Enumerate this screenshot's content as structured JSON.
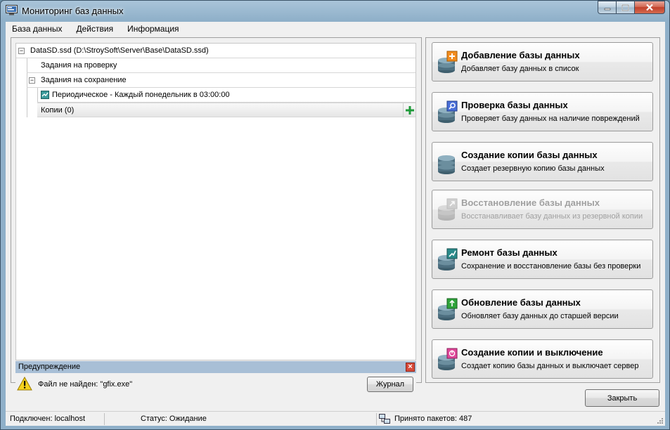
{
  "window": {
    "title": "Мониторинг баз данных"
  },
  "menu": [
    "База данных",
    "Действия",
    "Информация"
  ],
  "tree": {
    "root": "DataSD.ssd (D:\\StroySoft\\Server\\Base\\DataSD.ssd)",
    "check_tasks": "Задания на проверку",
    "save_tasks": "Задания на сохранение",
    "periodic_task": "Периодическое - Каждый понедельник в 03:00:00",
    "copies": "Копии (0)"
  },
  "warning": {
    "title": "Предупреждение",
    "message": "Файл не найден: \"gfix.exe\"",
    "journal_button": "Журнал"
  },
  "actions": [
    {
      "title": "Добавление базы данных",
      "desc": "Добавляет базу данных в список",
      "icon": "database-add-icon",
      "enabled": true
    },
    {
      "title": "Проверка базы данных",
      "desc": "Проверяет базу данных на наличие повреждений",
      "icon": "database-check-icon",
      "enabled": true
    },
    {
      "title": "Создание копии базы данных",
      "desc": "Создает резервную копию базы данных",
      "icon": "database-backup-icon",
      "enabled": true
    },
    {
      "title": "Восстановление базы данных",
      "desc": "Восстанавливает базу данных из резервной копии",
      "icon": "database-restore-icon",
      "enabled": false
    },
    {
      "title": "Ремонт базы данных",
      "desc": "Сохранение и восстановление базы без проверки",
      "icon": "database-repair-icon",
      "enabled": true
    },
    {
      "title": "Обновление базы данных",
      "desc": "Обновляет базу данных до старшей версии",
      "icon": "database-update-icon",
      "enabled": true
    },
    {
      "title": "Создание копии и выключение",
      "desc": "Создает копию базы данных и выключает сервер",
      "icon": "database-backup-shutdown-icon",
      "enabled": true
    }
  ],
  "close_button": "Закрыть",
  "status": {
    "connected": "Подключен: localhost",
    "state": "Статус: Ожидание",
    "packets": "Принято пакетов: 487"
  },
  "colors": {
    "accent_add": "#f28c1e",
    "accent_check": "#4a6fd8",
    "accent_repair": "#2a8a8a",
    "accent_update": "#2ea33a",
    "accent_shutdown": "#e0489a",
    "db_stack": "#3f5f6e"
  }
}
